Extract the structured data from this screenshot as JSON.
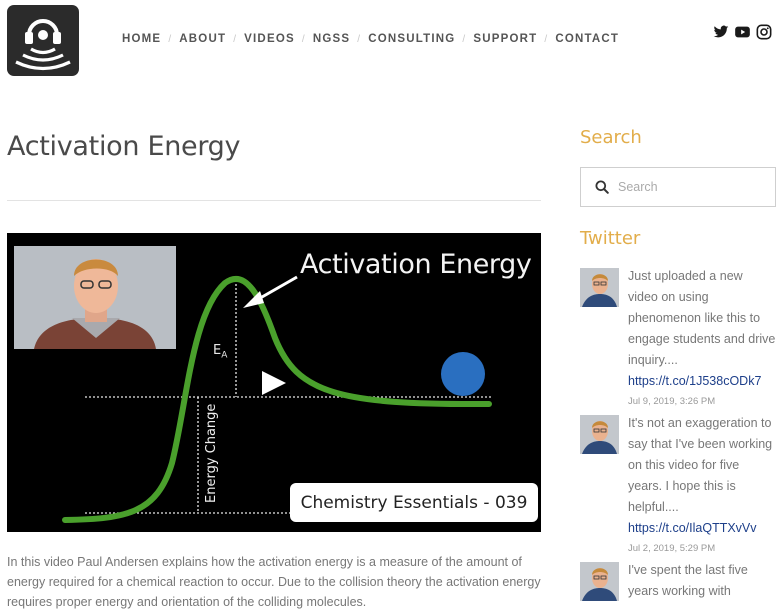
{
  "nav": [
    "HOME",
    "ABOUT",
    "VIDEOS",
    "NGSS",
    "CONSULTING",
    "SUPPORT",
    "CONTACT"
  ],
  "social": [
    "twitter-icon",
    "youtube-icon",
    "instagram-icon"
  ],
  "page": {
    "title": "Activation Energy",
    "video": {
      "title": "Activation Energy",
      "ea_label_main": "E",
      "ea_label_sub": "A",
      "y_axis_label": "Energy Change",
      "series_badge": "Chemistry Essentials - 039"
    },
    "description": "In this video Paul Andersen explains how the activation energy is a measure of the amount of energy required for a chemical reaction to occur. Due to the collision theory the activation energy requires proper energy and orientation of the colliding molecules."
  },
  "sidebar": {
    "search_heading": "Search",
    "search_placeholder": "Search",
    "twitter_heading": "Twitter",
    "tweets": [
      {
        "text": "Just uploaded a new video on using phenomenon like this to engage students and drive inquiry....",
        "link": "https://t.co/1J538cODk7",
        "date": "Jul 9, 2019, 3:26 PM"
      },
      {
        "text": "It's not an exaggeration to say that I've been working on this video for five years. I hope this is helpful....",
        "link": "https://t.co/IlaQTTXvVv",
        "date": "Jul 2, 2019, 5:29 PM"
      },
      {
        "text": "I've spent the last five years working with",
        "link": "",
        "date": ""
      }
    ]
  },
  "colors": {
    "accent": "#e2ad4a",
    "link": "#1d3f8a",
    "curve": "#4aa02c",
    "ball": "#2a6fc0"
  }
}
